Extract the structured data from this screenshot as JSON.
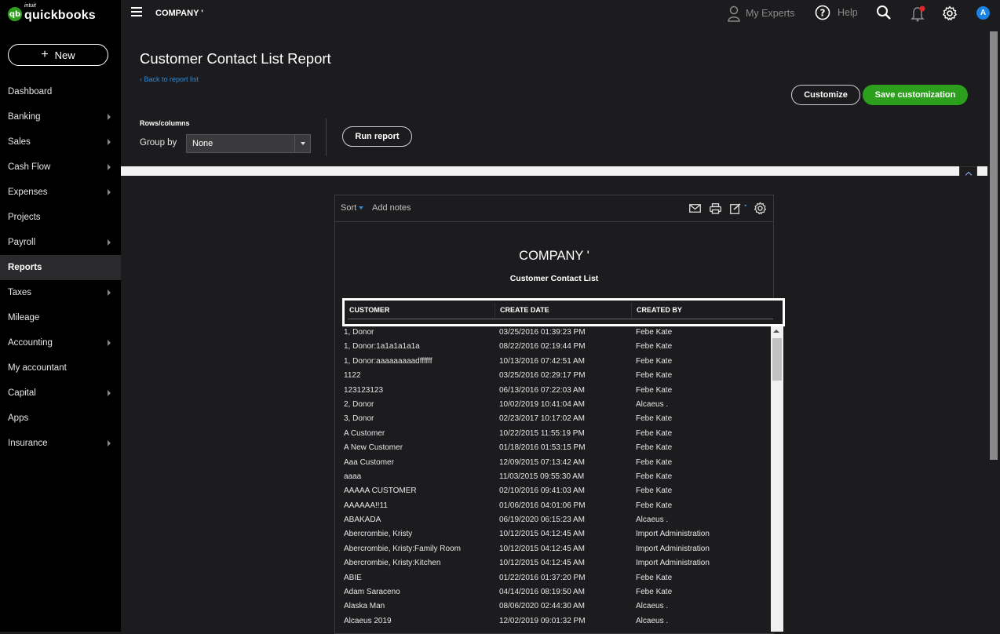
{
  "app": {
    "logo_small": "intuit",
    "logo_name": "quickbooks",
    "logo_badge": "qb",
    "company": "COMPANY '"
  },
  "sidebar": {
    "new_label": "New",
    "items": [
      {
        "label": "Dashboard",
        "caret": false
      },
      {
        "label": "Banking",
        "caret": true
      },
      {
        "label": "Sales",
        "caret": true
      },
      {
        "label": "Cash Flow",
        "caret": true
      },
      {
        "label": "Expenses",
        "caret": true
      },
      {
        "label": "Projects",
        "caret": false
      },
      {
        "label": "Payroll",
        "caret": true
      },
      {
        "label": "Reports",
        "caret": false,
        "active": true
      },
      {
        "label": "Taxes",
        "caret": true
      },
      {
        "label": "Mileage",
        "caret": false
      },
      {
        "label": "Accounting",
        "caret": true
      },
      {
        "label": "My accountant",
        "caret": false
      },
      {
        "label": "Capital",
        "caret": true
      },
      {
        "label": "Apps",
        "caret": false
      },
      {
        "label": "Insurance",
        "caret": true
      }
    ]
  },
  "topbar": {
    "experts_label": "My Experts",
    "help_label": "Help",
    "avatar_letter": "A"
  },
  "header": {
    "title": "Customer Contact List Report",
    "back_link": "Back to report list",
    "customize_label": "Customize",
    "save_label": "Save customization",
    "rows_columns_label": "Rows/columns",
    "group_by_label": "Group by",
    "group_by_value": "None",
    "run_report_label": "Run report"
  },
  "report": {
    "sort_label": "Sort",
    "add_notes_label": "Add notes",
    "company": "COMPANY '",
    "title": "Customer Contact List",
    "columns": [
      "CUSTOMER",
      "CREATE DATE",
      "CREATED BY"
    ],
    "rows": [
      [
        "1, Donor",
        "03/25/2016 01:39:23 PM",
        "Febe Kate"
      ],
      [
        "1, Donor:1a1a1a1a1a",
        "08/22/2016 02:19:44 PM",
        "Febe Kate"
      ],
      [
        "1, Donor:aaaaaaaaadffffff",
        "10/13/2016 07:42:51 AM",
        "Febe Kate"
      ],
      [
        "1122",
        "03/25/2016 02:29:17 PM",
        "Febe Kate"
      ],
      [
        "123123123",
        "06/13/2016 07:22:03 AM",
        "Febe Kate"
      ],
      [
        "2, Donor",
        "10/02/2019 10:41:04 AM",
        "Alcaeus ."
      ],
      [
        "3, Donor",
        "02/23/2017 10:17:02 AM",
        "Febe Kate"
      ],
      [
        "A Customer",
        "10/22/2015 11:55:19 PM",
        "Febe Kate"
      ],
      [
        "A New Customer",
        "01/18/2016 01:53:15 PM",
        "Febe Kate"
      ],
      [
        "Aaa Customer",
        "12/09/2015 07:13:42 AM",
        "Febe Kate"
      ],
      [
        "aaaa",
        "11/03/2015 09:55:30 AM",
        "Febe Kate"
      ],
      [
        "AAAAA CUSTOMER",
        "02/10/2016 09:41:03 AM",
        "Febe Kate"
      ],
      [
        "AAAAAA!!11",
        "01/06/2016 04:01:06 PM",
        "Febe Kate"
      ],
      [
        "ABAKADA",
        "06/19/2020 06:15:23 AM",
        "Alcaeus ."
      ],
      [
        "Abercrombie, Kristy",
        "10/12/2015 04:12:45 AM",
        "Import Administration"
      ],
      [
        "Abercrombie, Kristy:Family Room",
        "10/12/2015 04:12:45 AM",
        "Import Administration"
      ],
      [
        "Abercrombie, Kristy:Kitchen",
        "10/12/2015 04:12:45 AM",
        "Import Administration"
      ],
      [
        "ABIE",
        "01/22/2016 01:37:20 PM",
        "Febe Kate"
      ],
      [
        "Adam Saraceno",
        "04/14/2016 08:19:50 AM",
        "Febe Kate"
      ],
      [
        "Alaska Man",
        "08/06/2020 02:44:30 AM",
        "Alcaeus ."
      ],
      [
        "Alcaeus 2019",
        "12/02/2019 09:01:32 PM",
        "Alcaeus ."
      ]
    ]
  },
  "colors": {
    "accent_green": "#2ca01c",
    "link_blue": "#2d8ad8",
    "sidebar_bg": "#000000",
    "page_bg": "#1c1c1e",
    "notification_dot": "#e0262b",
    "avatar_bg": "#1a82e2"
  }
}
